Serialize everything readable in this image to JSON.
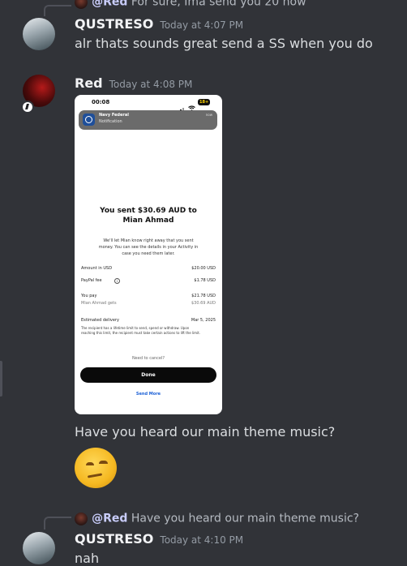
{
  "messages": {
    "first_reply": {
      "author": "@Red",
      "text": "For sure, Ima send you 20 now"
    },
    "m1": {
      "author": "QUSTRESO",
      "timestamp": "Today at 4:07 PM",
      "text": "alr thats sounds great send a SS when you do"
    },
    "m2": {
      "author": "Red",
      "timestamp": "Today at 4:08 PM",
      "text": "Have you heard our main theme music?"
    },
    "m3": {
      "reply_author": "@Red",
      "reply_text": "Have you heard our main theme music?",
      "author": "QUSTRESO",
      "timestamp": "Today at 4:10 PM",
      "text": "nah"
    }
  },
  "screenshot": {
    "status_time": "00:08",
    "battery": "18+",
    "notif_title": "Navy Federal",
    "notif_subtitle": "Notification",
    "notif_when": "now",
    "heading_line1": "You sent $30.69 AUD to",
    "heading_line2": "Mian Ahmad",
    "body_line1": "We'll let Mian know right away that you sent",
    "body_line2": "money. You can see the details in your Activity in",
    "body_line3": "case you need them later.",
    "amount_label": "Amount in USD",
    "amount_value": "$20.00 USD",
    "fee_label": "PayPal fee",
    "fee_value": "$1.78 USD",
    "pay_label": "You pay",
    "pay_value": "$21.78 USD",
    "gets_label": "Mian Ahmad gets",
    "gets_value": "$30.69 AUD",
    "delivery_label": "Estimated delivery",
    "delivery_value": "Mar 5, 2025",
    "limit_line1": "The recipient has a lifetime limit to send, spend or withdraw. Upon",
    "limit_line2": "reaching this limit, the recipient must take certain actions to lift the limit.",
    "cancel_text": "Need to cancel?",
    "done_label": "Done",
    "send_more_label": "Send More"
  },
  "colors": {
    "background": "#313338",
    "username": "#f2f3f5",
    "text": "#dbdee1",
    "timestamp": "#949ba4",
    "mention": "#c9cdfb",
    "link_blue": "#1a5fd6"
  },
  "icons": [
    "status-badge-icon",
    "info-icon",
    "wifi-icon",
    "signal-icon",
    "battery-icon",
    "bank-logo-icon",
    "smug-emoji"
  ]
}
